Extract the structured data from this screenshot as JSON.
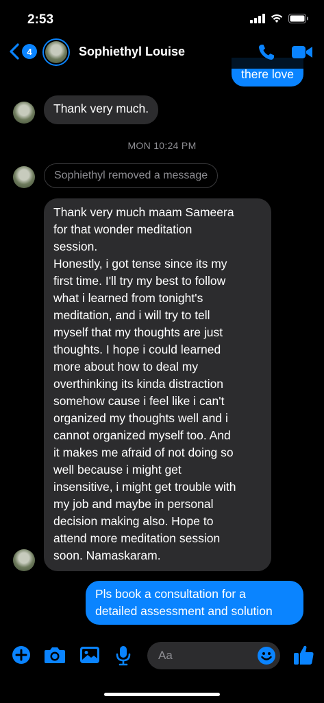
{
  "status": {
    "time": "2:53"
  },
  "header": {
    "back_count": "4",
    "contact_name": "Sophiethyl Louise"
  },
  "messages": {
    "partial_out": "there love",
    "in1": "Thank very much.",
    "timestamp": "MON 10:24 PM",
    "removed_notice": "Sophiethyl removed a message",
    "in_long": [
      "Thank very much maam Sameera",
      "for that wonder meditation",
      "session.",
      "Honestly, i got tense since its my",
      "first time. I'll try my best to follow",
      "what i learned from tonight's",
      "meditation, and i will try to tell",
      "myself that my thoughts are just",
      "thoughts. I hope i could learned",
      "more about how to deal my",
      "overthinking its kinda distraction",
      "somehow cause i feel like i can't",
      "organized my thoughts well and i",
      "cannot organized myself too. And",
      "it makes me afraid of not doing so",
      "well because i might get",
      "insensitive, i might get trouble with",
      "my job and maybe in personal",
      "decision making also. Hope to",
      "attend more meditation session",
      "soon. Namaskaram."
    ],
    "out_last": [
      "Pls book a consultation for a",
      "detailed assessment and solution"
    ]
  },
  "composer": {
    "placeholder": "Aa"
  },
  "colors": {
    "accent": "#0a84ff",
    "bubble_in": "#2c2c2e",
    "background": "#000000",
    "muted": "#8e8e93"
  },
  "icons": [
    "back-chevron-icon",
    "phone-icon",
    "video-icon",
    "plus-icon",
    "camera-icon",
    "gallery-icon",
    "microphone-icon",
    "emoji-icon",
    "thumbs-up-icon"
  ]
}
